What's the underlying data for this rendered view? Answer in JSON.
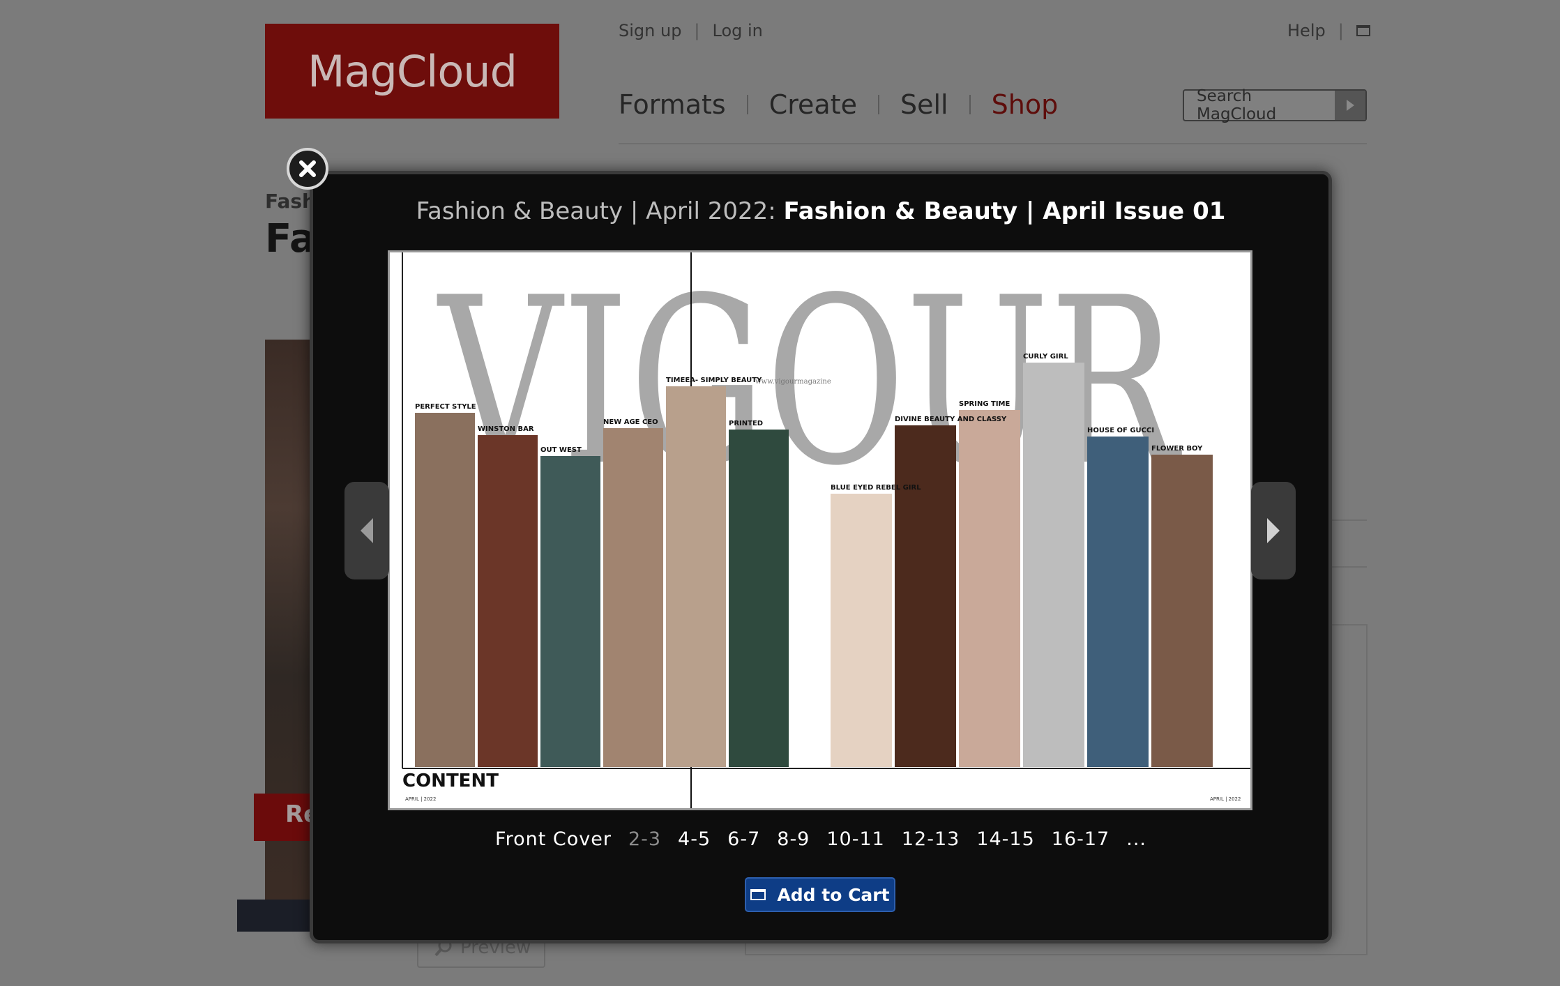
{
  "site": {
    "logo_text": "MagCloud",
    "top_links": [
      "Sign up",
      "Log in"
    ],
    "help_label": "Help",
    "nav": [
      "Formats",
      "Create",
      "Sell",
      "Shop"
    ],
    "search_placeholder": "Search MagCloud",
    "bg_category": "Fash",
    "bg_title": "Fa",
    "bg_read_button": "Re",
    "bg_preview_button": "Preview"
  },
  "modal": {
    "title_prefix": "Fashion & Beauty | April 2022:",
    "title_bold": "Fashion & Beauty | April Issue 01",
    "spread": {
      "masthead": "VIGOUR",
      "content_heading": "CONTENT",
      "date_left": "APRIL | 2022",
      "date_right": "APRIL | 2022",
      "watermark": "www.vigourmagazine",
      "left_labels": [
        "PERFECT STYLE",
        "WINSTON BAR",
        "OUT WEST",
        "NEW AGE CEO",
        "TIMEEA- SIMPLY BEAUTY",
        "PRINTED"
      ],
      "right_labels": [
        "BLUE EYED REBEL GIRL",
        "DIVINE BEAUTY AND CLASSY",
        "SPRING TIME",
        "CURLY GIRL",
        "HOUSE OF GUCCI",
        "FLOWER BOY"
      ]
    },
    "pages": [
      "Front Cover",
      "2-3",
      "4-5",
      "6-7",
      "8-9",
      "10-11",
      "12-13",
      "14-15",
      "16-17",
      "..."
    ],
    "current_page": "2-3",
    "add_to_cart_label": "Add to Cart"
  }
}
